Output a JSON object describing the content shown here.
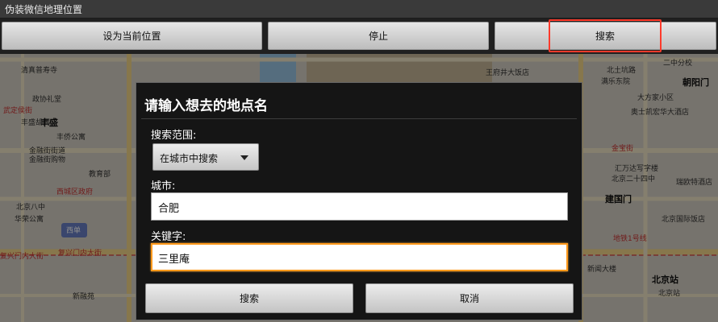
{
  "app": {
    "title": "伪装微信地理位置"
  },
  "toolbar": {
    "set_current": "设为当前位置",
    "stop": "停止",
    "search": "搜索"
  },
  "map": {
    "pois": [
      "清真普寿寺",
      "政协礼堂",
      "武定侯街",
      "丰盛胡同",
      "丰盛",
      "金融街街道",
      "丰侨公寓",
      "金融街购物",
      "西城区政府",
      "教育部",
      "北京八中",
      "华荣公寓",
      "西单",
      "复兴门内大街",
      "复兴门内大街",
      "新融苑",
      "王府井大饭店",
      "二中分校",
      "朝阳门",
      "北土坑路",
      "满乐东院",
      "大方家小区",
      "奥士凯宏华大酒店",
      "金宝街",
      "汇万达写字楼",
      "北京二十四中",
      "瑞欧特酒店",
      "建国门",
      "北京国际饭店",
      "地铁1号线",
      "新闻大楼",
      "北京站",
      "北京站"
    ]
  },
  "dialog": {
    "title": "请输入想去的地点名",
    "scope_label": "搜索范围:",
    "scope_value": "在城市中搜索",
    "city_label": "城市:",
    "city_value": "合肥",
    "keyword_label": "关键字:",
    "keyword_value": "三里庵",
    "search_button": "搜索",
    "cancel_button": "取消"
  },
  "colors": {
    "highlight_border": "#ff3a2b",
    "focus_border": "#ff9a1c",
    "dialog_bg": "#151515"
  }
}
